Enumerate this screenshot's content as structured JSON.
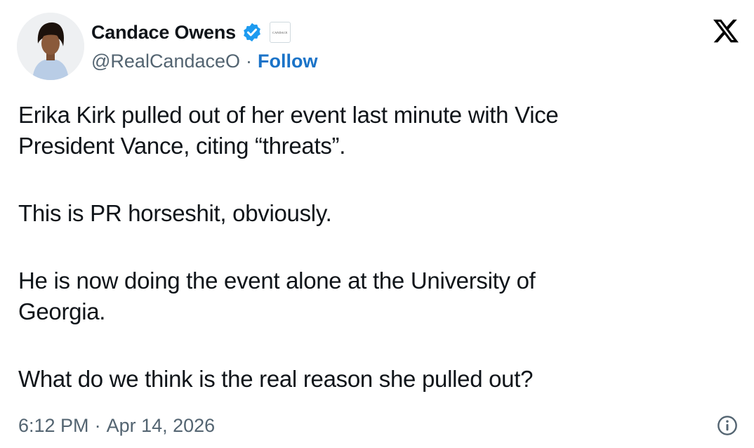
{
  "author": {
    "display_name": "Candace Owens",
    "handle": "@RealCandaceO",
    "separator": "·",
    "follow_label": "Follow",
    "affiliate_badge_text": "CANDACE"
  },
  "tweet": {
    "paragraphs": [
      "Erika Kirk pulled out of her event last minute with Vice\nPresident Vance, citing “threats”.",
      "This is PR horseshit, obviously.",
      "He is now doing the event alone at the University of\nGeorgia.",
      "What do we think is the real reason she pulled out?"
    ],
    "time": "6:12 PM",
    "separator": "·",
    "date": "Apr 14, 2026"
  },
  "icons": {
    "verified": "verified-badge-icon",
    "platform": "x-logo-icon",
    "info": "info-icon"
  },
  "colors": {
    "verified_blue": "#1d9bf0",
    "follow_link": "#1a73c8",
    "secondary_text": "#536471",
    "primary_text": "#0f1419"
  }
}
